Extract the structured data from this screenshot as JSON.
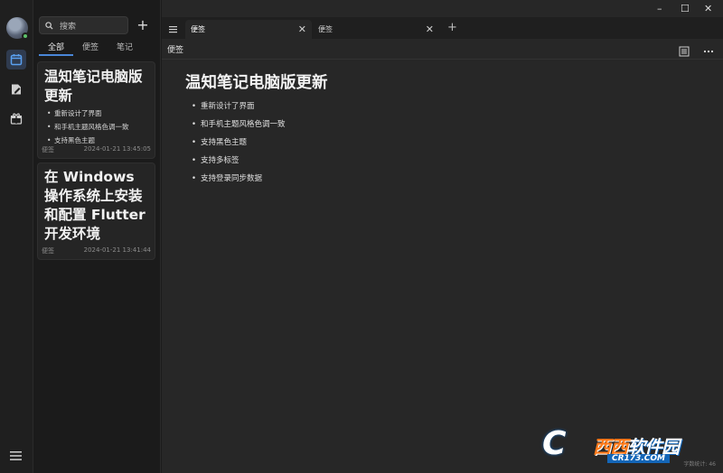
{
  "sidebar": {
    "search_placeholder": "搜索",
    "filters": [
      "全部",
      "便签",
      "笔记"
    ],
    "notes": [
      {
        "title": "温知笔记电脑版更新",
        "bullets": [
          "重新设计了界面",
          "和手机主题风格色调一致",
          "支持黑色主题"
        ],
        "type": "便签",
        "time": "2024-01-21 13:45:05"
      },
      {
        "title": "在 Windows 操作系统上安装和配置 Flutter 开发环境",
        "bullets": [],
        "type": "便签",
        "time": "2024-01-21 13:41:44"
      }
    ]
  },
  "tabs": [
    {
      "label": "便签",
      "active": true
    },
    {
      "label": "便签",
      "active": false
    }
  ],
  "window": {
    "minimize": "–",
    "maximize": "☐",
    "close": "✕"
  },
  "editor": {
    "breadcrumb": "便签",
    "title": "温知笔记电脑版更新",
    "bullets": [
      "重新设计了界面",
      "和手机主题风格色调一致",
      "支持黑色主题",
      "支持多标签",
      "支持登录同步数据"
    ],
    "word_count": "字数统计: 46"
  },
  "watermark": {
    "letter": "C",
    "brand1": "西西",
    "brand2": "软件园",
    "url": "CR173.COM"
  },
  "colors": {
    "accent": "#4a86d8",
    "background": "#272727"
  }
}
